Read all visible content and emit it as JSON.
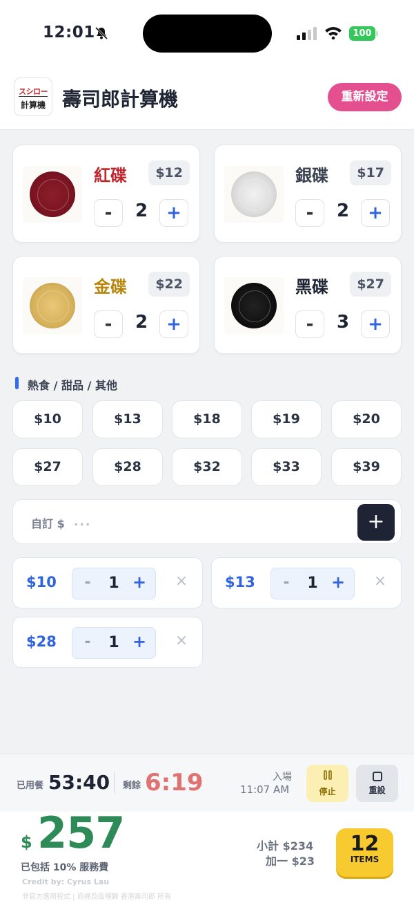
{
  "status_bar": {
    "time": "12:01",
    "battery": "100"
  },
  "header": {
    "logo_top": "スシロー",
    "logo_bottom": "計算機",
    "title": "壽司郎計算機",
    "reset_label": "重新設定"
  },
  "plates": [
    {
      "name": "紅碟",
      "price": "$12",
      "qty": "2",
      "color": "#c0272d"
    },
    {
      "name": "銀碟",
      "price": "$17",
      "qty": "2",
      "color": "#3b4252"
    },
    {
      "name": "金碟",
      "price": "$22",
      "qty": "2",
      "color": "#b8860b"
    },
    {
      "name": "黑碟",
      "price": "$27",
      "qty": "3",
      "color": "#1e2433"
    }
  ],
  "plate_controls": {
    "minus": "-",
    "plus": "+"
  },
  "section": {
    "title": "熱食 / 甜品 / 其他"
  },
  "price_buttons": [
    "$10",
    "$13",
    "$18",
    "$19",
    "$20",
    "$27",
    "$28",
    "$32",
    "$33",
    "$39"
  ],
  "custom": {
    "label": "自訂 $",
    "placeholder": "...",
    "add": "+"
  },
  "added_items": [
    {
      "price": "$10",
      "qty": "1"
    },
    {
      "price": "$13",
      "qty": "1"
    },
    {
      "price": "$28",
      "qty": "1"
    }
  ],
  "item_controls": {
    "minus": "-",
    "plus": "+",
    "remove": "×"
  },
  "timer": {
    "used_label": "已用餐",
    "used_time": "53:40",
    "remain_label": "剩餘",
    "remain_time": "6:19",
    "enter_label": "入場",
    "enter_time": "11:07 AM",
    "pause_label": "停止",
    "reset_label": "重設"
  },
  "summary": {
    "currency": "$",
    "total": "257",
    "service_note": "已包括 10% 服務費",
    "credit": "Credit by: Cyrus Lau",
    "fine_print": "非官方應用程式 | 商標及版權歸 香港壽司郎 所有",
    "subtotal": "小計 $234",
    "addon": "加一 $23",
    "items_count": "12",
    "items_label": "ITEMS"
  }
}
